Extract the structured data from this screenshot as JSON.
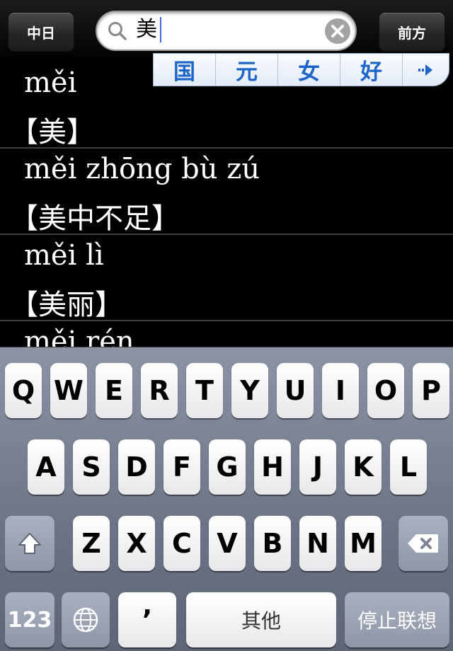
{
  "toolbar": {
    "left_button": "中日",
    "right_button": "前方"
  },
  "search": {
    "value": "美",
    "search_icon": "search-icon",
    "clear_icon": "clear-icon"
  },
  "candidates": [
    "国",
    "元",
    "女",
    "好"
  ],
  "results": [
    {
      "pinyin": "měi",
      "open": "【",
      "hanzi": "美",
      "close": "】"
    },
    {
      "pinyin": "měi zhōng bù zú",
      "open": "【",
      "hanzi": "美中不足",
      "close": "】"
    },
    {
      "pinyin": "měi lì",
      "open": "【",
      "hanzi": "美丽",
      "close": "】"
    },
    {
      "pinyin": "měi rén",
      "open": "",
      "hanzi": "",
      "close": ""
    }
  ],
  "keyboard": {
    "row1": [
      "Q",
      "W",
      "E",
      "R",
      "T",
      "Y",
      "U",
      "I",
      "O",
      "P"
    ],
    "row2": [
      "A",
      "S",
      "D",
      "F",
      "G",
      "H",
      "J",
      "K",
      "L"
    ],
    "row3": [
      "Z",
      "X",
      "C",
      "V",
      "B",
      "N",
      "M"
    ],
    "numbers_key": "123",
    "apostrophe_key": "’",
    "space_key": "其他",
    "return_key": "停止联想",
    "shift_icon": "shift-icon",
    "backspace_icon": "backspace-icon",
    "globe_icon": "globe-icon"
  }
}
